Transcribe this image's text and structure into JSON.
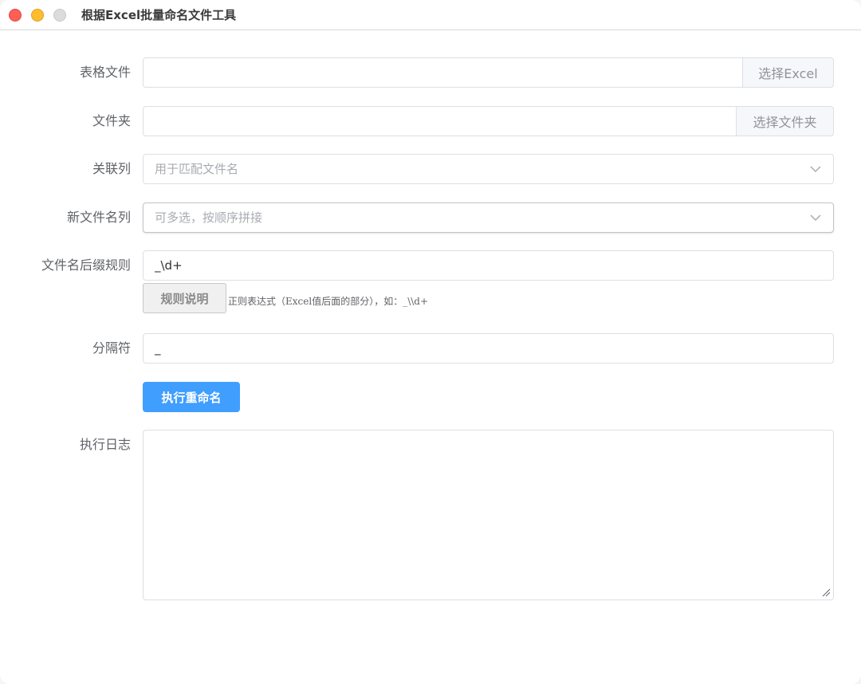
{
  "window": {
    "title": "根据Excel批量命名文件工具"
  },
  "form": {
    "excel_file": {
      "label": "表格文件",
      "value": "",
      "button": "选择Excel"
    },
    "folder": {
      "label": "文件夹",
      "value": "",
      "button": "选择文件夹"
    },
    "key_column": {
      "label": "关联列",
      "placeholder": "用于匹配文件名"
    },
    "new_name_columns": {
      "label": "新文件名列",
      "placeholder": "可多选，按顺序拼接"
    },
    "suffix_rule": {
      "label": "文件名后缀规则",
      "value": "_\\d+",
      "help_button": "规则说明",
      "hint": "正则表达式（Excel值后面的部分），如：_\\\\d+"
    },
    "separator": {
      "label": "分隔符",
      "value": "_"
    },
    "run_button": "执行重命名",
    "log": {
      "label": "执行日志",
      "value": ""
    }
  },
  "icons": {
    "select_arrow": "chevron-down-icon",
    "textarea_resize": "resize-grip-icon"
  },
  "colors": {
    "primary": "#409eff",
    "close": "#fe5f57",
    "minimize": "#febc2e",
    "maximize": "#dcdcdc"
  }
}
